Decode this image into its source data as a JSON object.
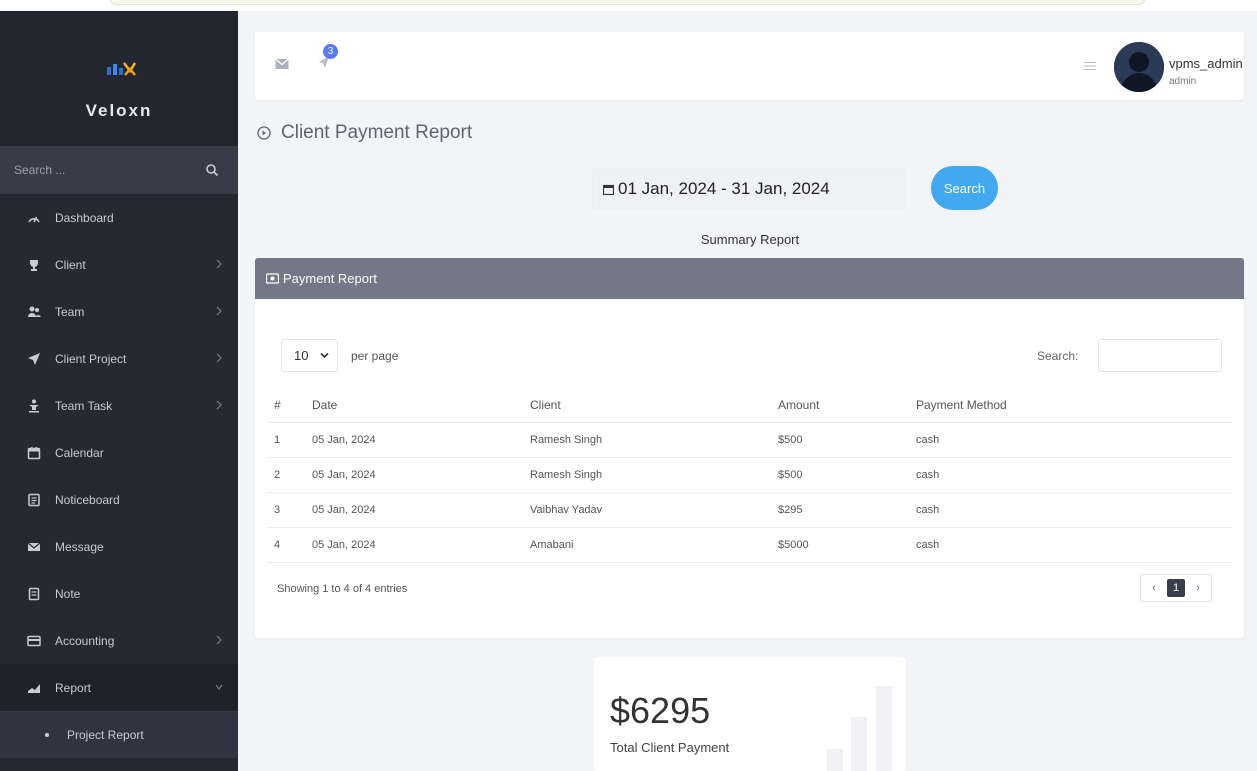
{
  "brand": {
    "name": "Veloxn"
  },
  "sidebar": {
    "search_placeholder": "Search ...",
    "items": [
      {
        "label": "Dashboard",
        "icon": "gauge-icon",
        "has_chevron": false
      },
      {
        "label": "Client",
        "icon": "trophy-icon",
        "has_chevron": true
      },
      {
        "label": "Team",
        "icon": "users-icon",
        "has_chevron": true
      },
      {
        "label": "Client Project",
        "icon": "send-icon",
        "has_chevron": true
      },
      {
        "label": "Team Task",
        "icon": "person-icon",
        "has_chevron": true
      },
      {
        "label": "Calendar",
        "icon": "calendar-icon",
        "has_chevron": false
      },
      {
        "label": "Noticeboard",
        "icon": "clipboard-icon",
        "has_chevron": false
      },
      {
        "label": "Message",
        "icon": "mail-icon",
        "has_chevron": false
      },
      {
        "label": "Note",
        "icon": "note-icon",
        "has_chevron": false
      },
      {
        "label": "Accounting",
        "icon": "card-icon",
        "has_chevron": true
      },
      {
        "label": "Report",
        "icon": "area-chart-icon",
        "has_chevron": true,
        "expanded": true
      }
    ],
    "subitems": [
      {
        "label": "Project Report"
      }
    ]
  },
  "header": {
    "notification_count": "3",
    "username": "vpms_admin",
    "role": "admin"
  },
  "page": {
    "title": "Client Payment Report",
    "date_range": "01 Jan, 2024 - 31 Jan, 2024",
    "search_button": "Search",
    "summary_heading": "Summary Report"
  },
  "report": {
    "heading": "Payment Report",
    "per_page_value": "10",
    "per_page_label": "per page",
    "search_label": "Search:",
    "columns": [
      "#",
      "Date",
      "Client",
      "Amount",
      "Payment Method"
    ],
    "rows": [
      [
        "1",
        "05 Jan, 2024",
        "Ramesh Singh",
        "$500",
        "cash"
      ],
      [
        "2",
        "05 Jan, 2024",
        "Ramesh Singh",
        "$500",
        "cash"
      ],
      [
        "3",
        "05 Jan, 2024",
        "Vaibhav Yadav",
        "$295",
        "cash"
      ],
      [
        "4",
        "05 Jan, 2024",
        "Amabani",
        "$5000",
        "cash"
      ]
    ],
    "showing": "Showing 1 to 4 of 4 entries",
    "pager": {
      "prev": "‹",
      "current": "1",
      "next": "›"
    }
  },
  "stat": {
    "amount": "$6295",
    "label": "Total Client Payment"
  },
  "colors": {
    "sidebar_bg": "#262833",
    "card_header": "#737787",
    "primary_button": "#42a8f0",
    "badge": "#5a77ff"
  }
}
